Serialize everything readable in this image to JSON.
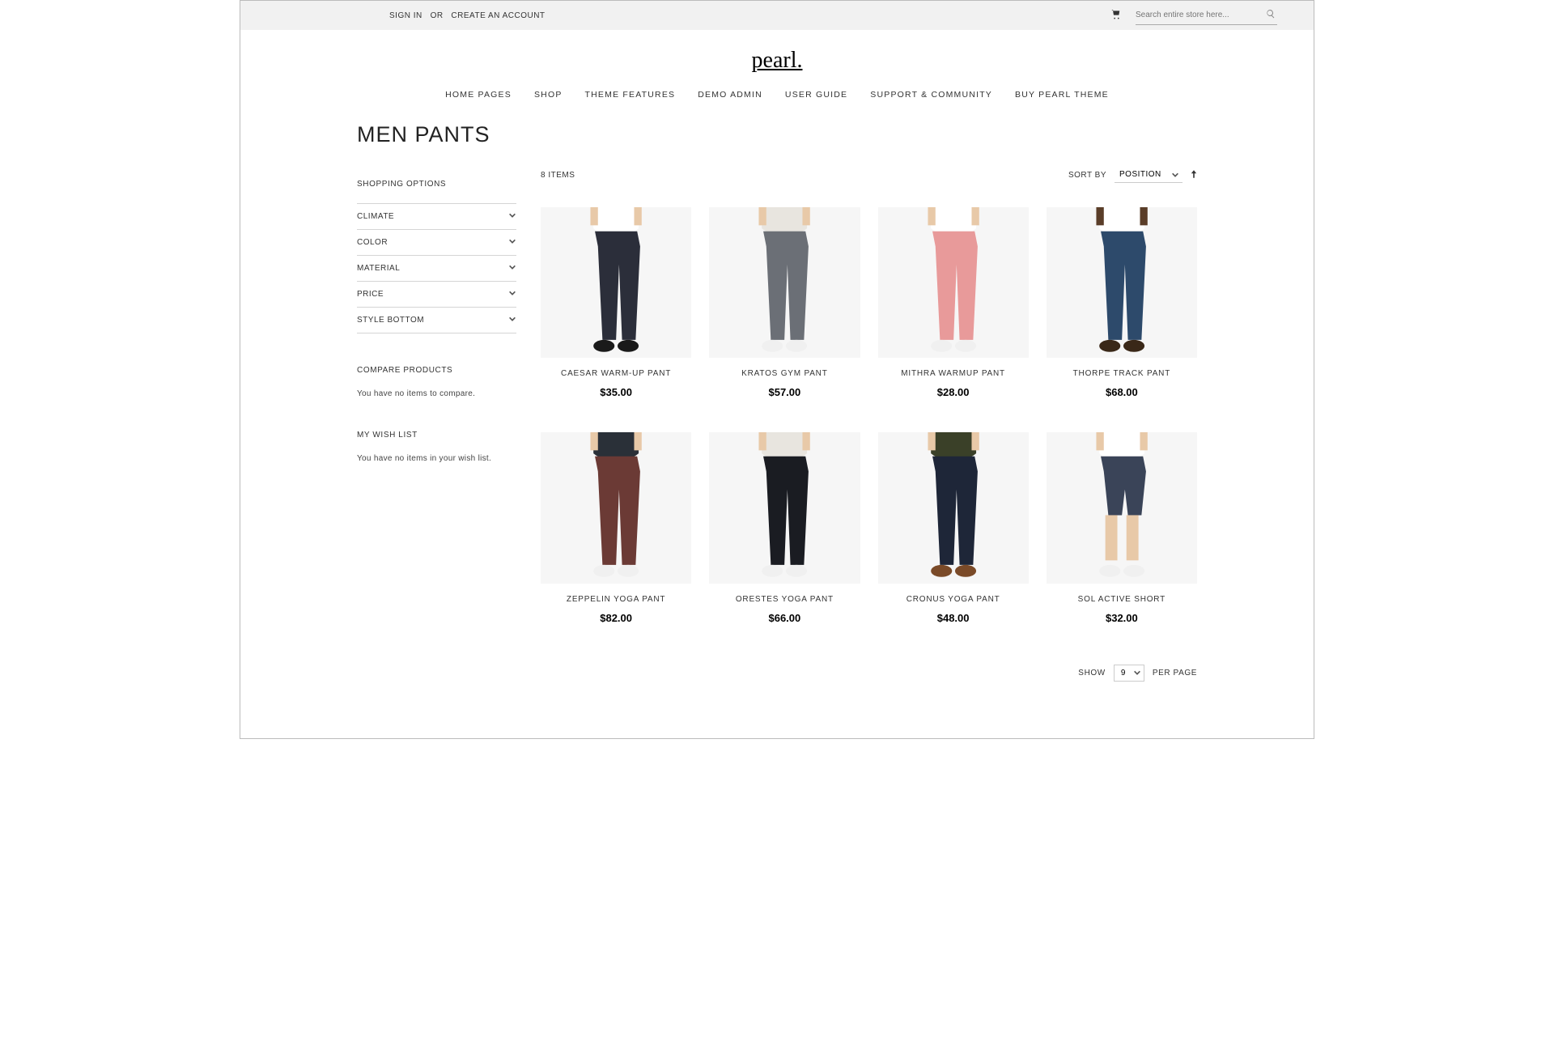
{
  "top": {
    "sign_in": "SIGN IN",
    "or": "OR",
    "create": "CREATE AN ACCOUNT",
    "search_placeholder": "Search entire store here..."
  },
  "logo": "pearl.",
  "nav": [
    "HOME PAGES",
    "SHOP",
    "THEME FEATURES",
    "DEMO ADMIN",
    "USER GUIDE",
    "SUPPORT & COMMUNITY",
    "BUY PEARL THEME"
  ],
  "page_title": "MEN PANTS",
  "sidebar": {
    "shopping_options": "SHOPPING OPTIONS",
    "filters": [
      "CLIMATE",
      "COLOR",
      "MATERIAL",
      "PRICE",
      "STYLE BOTTOM"
    ],
    "compare_title": "COMPARE PRODUCTS",
    "compare_empty": "You have no items to compare.",
    "wish_title": "MY WISH LIST",
    "wish_empty": "You have no items in your wish list."
  },
  "toolbar": {
    "count": "8 ITEMS",
    "sort_by": "SORT BY",
    "sort_value": "POSITION",
    "show": "SHOW",
    "per_page": "PER PAGE",
    "limit": "9"
  },
  "products": [
    {
      "name": "CAESAR WARM-UP PANT",
      "price": "$35.00",
      "c_pant": "#2b2e3a",
      "c_top": "#ffffff",
      "c_skin": "#e8c9a8",
      "c_shoe": "#1a1a1a",
      "type": "pant"
    },
    {
      "name": "KRATOS GYM PANT",
      "price": "$57.00",
      "c_pant": "#6b6f76",
      "c_top": "#e8e5df",
      "c_skin": "#e8c9a8",
      "c_shoe": "#f0f0f0",
      "type": "pant"
    },
    {
      "name": "MITHRA WARMUP PANT",
      "price": "$28.00",
      "c_pant": "#e89a9a",
      "c_top": "#ffffff",
      "c_skin": "#e8c9a8",
      "c_shoe": "#f0f0f0",
      "type": "pant"
    },
    {
      "name": "THORPE TRACK PANT",
      "price": "$68.00",
      "c_pant": "#2d4a6b",
      "c_top": "#ffffff",
      "c_skin": "#5a3d28",
      "c_shoe": "#3a2818",
      "type": "pant"
    },
    {
      "name": "ZEPPELIN YOGA PANT",
      "price": "$82.00",
      "c_pant": "#6b3a35",
      "c_top": "#2a3038",
      "c_skin": "#e8c9a8",
      "c_shoe": "#f0f0f0",
      "type": "pant"
    },
    {
      "name": "ORESTES YOGA PANT",
      "price": "$66.00",
      "c_pant": "#1a1c22",
      "c_top": "#e8e5df",
      "c_skin": "#e8c9a8",
      "c_shoe": "#f0f0f0",
      "type": "pant"
    },
    {
      "name": "CRONUS YOGA PANT",
      "price": "$48.00",
      "c_pant": "#1e2638",
      "c_top": "#3a4028",
      "c_skin": "#e8c9a8",
      "c_shoe": "#7a4a28",
      "type": "pant"
    },
    {
      "name": "SOL ACTIVE SHORT",
      "price": "$32.00",
      "c_pant": "#3a4458",
      "c_top": "#ffffff",
      "c_skin": "#e8c9a8",
      "c_shoe": "#f0f0f0",
      "type": "short"
    }
  ]
}
